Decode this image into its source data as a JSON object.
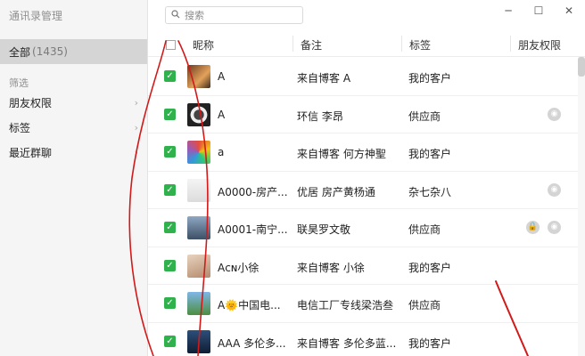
{
  "sidebar": {
    "title": "通讯录管理",
    "all_label": "全部",
    "all_count": "(1435)",
    "filter_label": "筛选",
    "items": [
      {
        "label": "朋友权限"
      },
      {
        "label": "标签"
      },
      {
        "label": "最近群聊"
      }
    ]
  },
  "search": {
    "placeholder": "搜索"
  },
  "window": {
    "minimize": "─",
    "maximize": "☐",
    "close": "✕"
  },
  "header": {
    "nickname": "昵称",
    "remark": "备注",
    "tag": "标签",
    "permission": "朋友权限"
  },
  "rows": [
    {
      "nickname": "A",
      "remark": "来自博客 A",
      "tag": "我的客户",
      "perm": []
    },
    {
      "nickname": "A",
      "remark": "环信 李昂",
      "tag": "供应商",
      "perm": [
        "moments-hidden-icon"
      ]
    },
    {
      "nickname": "a",
      "remark": "来自博客 何方神聖",
      "tag": "我的客户",
      "perm": []
    },
    {
      "nickname": "A0000-房产...",
      "remark": "优居 房产黄杨通",
      "tag": "杂七杂八",
      "perm": [
        "moments-hidden-icon"
      ]
    },
    {
      "nickname": "A0001-南宁...",
      "remark": "联昊罗文敬",
      "tag": "供应商",
      "perm": [
        "lock-icon",
        "moments-hidden-icon"
      ]
    },
    {
      "nickname": "Aᴄɴ小徐",
      "remark": "来自博客 小徐",
      "tag": "我的客户",
      "perm": []
    },
    {
      "nickname": "A🌞中国电...",
      "remark": "电信工厂专线梁浩叁",
      "tag": "供应商",
      "perm": []
    },
    {
      "nickname": "AAA 多伦多...",
      "remark": "来自博客 多伦多蓝...",
      "tag": "我的客户",
      "perm": []
    }
  ],
  "colors": {
    "check_green": "#2fb24c",
    "sidebar_bg": "#f5f5f5",
    "sidebar_selected": "#d5d5d5",
    "annotation_red": "#d11a1a"
  }
}
